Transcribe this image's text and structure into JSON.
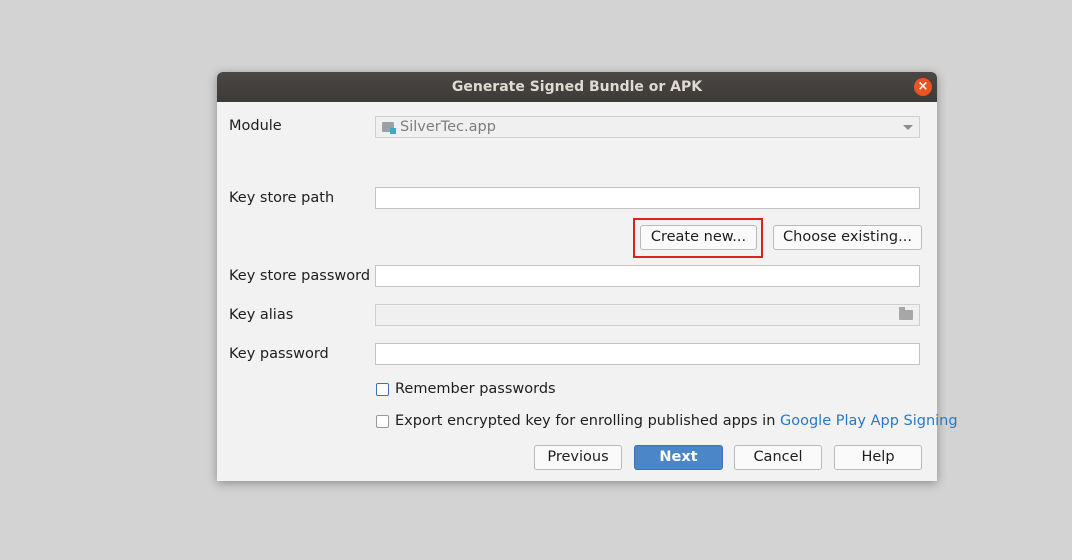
{
  "dialog": {
    "title": "Generate Signed Bundle or APK",
    "close_glyph": "×"
  },
  "form": {
    "module_label": "Module",
    "module_value": "SilverTec.app",
    "keystore_path_label": "Key store path",
    "keystore_path_value": "",
    "create_new_label": "Create new...",
    "choose_existing_label": "Choose existing...",
    "keystore_password_label": "Key store password",
    "keystore_password_value": "",
    "key_alias_label": "Key alias",
    "key_alias_value": "",
    "key_password_label": "Key password",
    "key_password_value": "",
    "remember_passwords_label": "Remember passwords",
    "remember_passwords_checked": false,
    "export_key_label": "Export encrypted key for enrolling published apps in",
    "export_key_link": "Google Play App Signing",
    "export_key_checked": false
  },
  "footer": {
    "previous_label": "Previous",
    "next_label": "Next",
    "cancel_label": "Cancel",
    "help_label": "Help"
  },
  "colors": {
    "accent": "#4a86c8",
    "highlight_box": "#d9241d",
    "close_button": "#e95420",
    "link": "#2a78c5"
  },
  "icons": {
    "module": "module-folder-icon",
    "dropdown": "chevron-down-icon",
    "browse": "folder-icon",
    "close": "close-icon"
  }
}
